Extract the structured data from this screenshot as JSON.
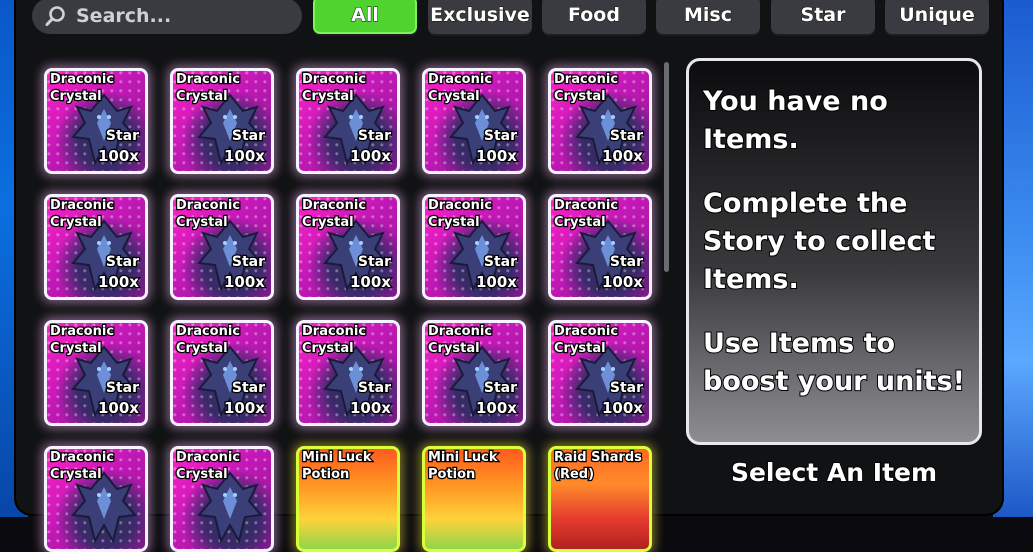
{
  "search": {
    "placeholder": "Search..."
  },
  "tabs": [
    {
      "label": "All",
      "active": true
    },
    {
      "label": "Exclusive",
      "active": false
    },
    {
      "label": "Food",
      "active": false
    },
    {
      "label": "Misc",
      "active": false
    },
    {
      "label": "Star",
      "active": false
    },
    {
      "label": "Unique",
      "active": false
    }
  ],
  "items": [
    {
      "name": "Draconic Crystal",
      "type": "Star",
      "qty": "100x",
      "style": "dragon"
    },
    {
      "name": "Draconic Crystal",
      "type": "Star",
      "qty": "100x",
      "style": "dragon"
    },
    {
      "name": "Draconic Crystal",
      "type": "Star",
      "qty": "100x",
      "style": "dragon"
    },
    {
      "name": "Draconic Crystal",
      "type": "Star",
      "qty": "100x",
      "style": "dragon"
    },
    {
      "name": "Draconic Crystal",
      "type": "Star",
      "qty": "100x",
      "style": "dragon"
    },
    {
      "name": "Draconic Crystal",
      "type": "Star",
      "qty": "100x",
      "style": "dragon"
    },
    {
      "name": "Draconic Crystal",
      "type": "Star",
      "qty": "100x",
      "style": "dragon"
    },
    {
      "name": "Draconic Crystal",
      "type": "Star",
      "qty": "100x",
      "style": "dragon"
    },
    {
      "name": "Draconic Crystal",
      "type": "Star",
      "qty": "100x",
      "style": "dragon"
    },
    {
      "name": "Draconic Crystal",
      "type": "Star",
      "qty": "100x",
      "style": "dragon"
    },
    {
      "name": "Draconic Crystal",
      "type": "Star",
      "qty": "100x",
      "style": "dragon"
    },
    {
      "name": "Draconic Crystal",
      "type": "Star",
      "qty": "100x",
      "style": "dragon"
    },
    {
      "name": "Draconic Crystal",
      "type": "Star",
      "qty": "100x",
      "style": "dragon"
    },
    {
      "name": "Draconic Crystal",
      "type": "Star",
      "qty": "100x",
      "style": "dragon"
    },
    {
      "name": "Draconic Crystal",
      "type": "Star",
      "qty": "100x",
      "style": "dragon"
    },
    {
      "name": "Draconic Crystal",
      "type": "",
      "qty": "",
      "style": "dragon"
    },
    {
      "name": "Draconic Crystal",
      "type": "",
      "qty": "",
      "style": "dragon"
    },
    {
      "name": "Mini Luck Potion",
      "type": "",
      "qty": "",
      "style": "potion"
    },
    {
      "name": "Mini Luck Potion",
      "type": "",
      "qty": "",
      "style": "potion"
    },
    {
      "name": "Raid Shards (Red)",
      "type": "",
      "qty": "",
      "style": "shard"
    }
  ],
  "info": {
    "line1": "You have no Items.",
    "line2": "Complete the Story to collect Items.",
    "line3": "Use Items to boost your units!"
  },
  "select_label": "Select An Item",
  "colors": {
    "active_tab": "#4fd32f",
    "tab": "#3a3b40",
    "card_pink": "#ff22c8"
  }
}
